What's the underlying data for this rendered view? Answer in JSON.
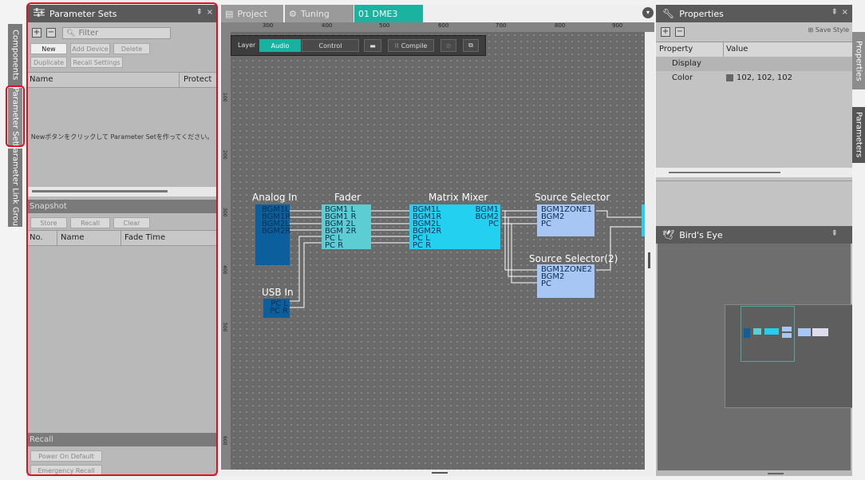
{
  "left_vtabs": [
    "Components",
    "Parameter Sets",
    "Parameter Link Group"
  ],
  "right_vtabs": [
    "Properties",
    "Parameters"
  ],
  "param_panel": {
    "title": "Parameter Sets",
    "pin": "⇞",
    "filter_placeholder": "Filter",
    "buttons": [
      "New",
      "Add Device",
      "Delete",
      "Duplicate",
      "Recall Settings"
    ],
    "table_headers": [
      "Name",
      "Protect"
    ],
    "empty_message": "Newボタンをクリックして Parameter Setを作ってください。",
    "snapshot": {
      "title": "Snapshot",
      "buttons": [
        "Store",
        "Recall",
        "Clear"
      ],
      "headers": [
        "No.",
        "Name",
        "Fade Time"
      ]
    },
    "recall": {
      "title": "Recall",
      "buttons": [
        "Power On Default",
        "Emergency Recall"
      ]
    }
  },
  "doc_tabs": [
    "Project",
    "Tuning",
    "01 DME3"
  ],
  "toolbar": {
    "layer_label": "Layer",
    "audio": "Audio",
    "control": "Control",
    "compile": "Compile"
  },
  "ruler_marks": [
    "300",
    "400",
    "500",
    "600",
    "700",
    "800",
    "900"
  ],
  "ruler_v_marks": [
    "100",
    "200",
    "300",
    "400",
    "500",
    "600"
  ],
  "components": {
    "analog_in": {
      "title": "Analog In",
      "ports": [
        "BGM1L",
        "BGM1R",
        "BGM2L",
        "BGM2R"
      ]
    },
    "fader": {
      "title": "Fader",
      "ports": [
        "BGM1 L",
        "BGM1 R",
        "BGM 2L",
        "BGM 2R",
        "PC L",
        "PC R"
      ]
    },
    "matrix": {
      "title": "Matrix Mixer",
      "inputs": [
        "BGM1L",
        "BGM1R",
        "BGM2L",
        "BGM2R",
        "PC L",
        "PC R"
      ],
      "outputs": [
        "BGM1",
        "BGM2",
        "PC"
      ]
    },
    "src_sel1": {
      "title": "Source Selector",
      "inputs": [
        "BGM1",
        "BGM2",
        "PC"
      ],
      "output": "ZONE1"
    },
    "src_sel2": {
      "title": "Source Selector(2)",
      "inputs": [
        "BGM1",
        "BGM2",
        "PC"
      ],
      "output": "ZONE2"
    },
    "usb_in": {
      "title": "USB In",
      "ports": [
        "PC L",
        "PC R"
      ]
    }
  },
  "properties": {
    "title": "Properties",
    "save_style": "Save Style",
    "headers": [
      "Property",
      "Value"
    ],
    "rows": [
      {
        "property": "Display",
        "value": ""
      },
      {
        "property": "Color",
        "value": "102, 102, 102"
      }
    ],
    "swatch_color": "#666666"
  },
  "birds_eye": {
    "title": "Bird's Eye"
  },
  "colors": {
    "accent": "#17b2a0",
    "analog": "#0b5f9c",
    "fader": "#5ccdd2",
    "matrix": "#24d0f0",
    "selector": "#a7c6f4",
    "highlight": "#e0101e"
  }
}
